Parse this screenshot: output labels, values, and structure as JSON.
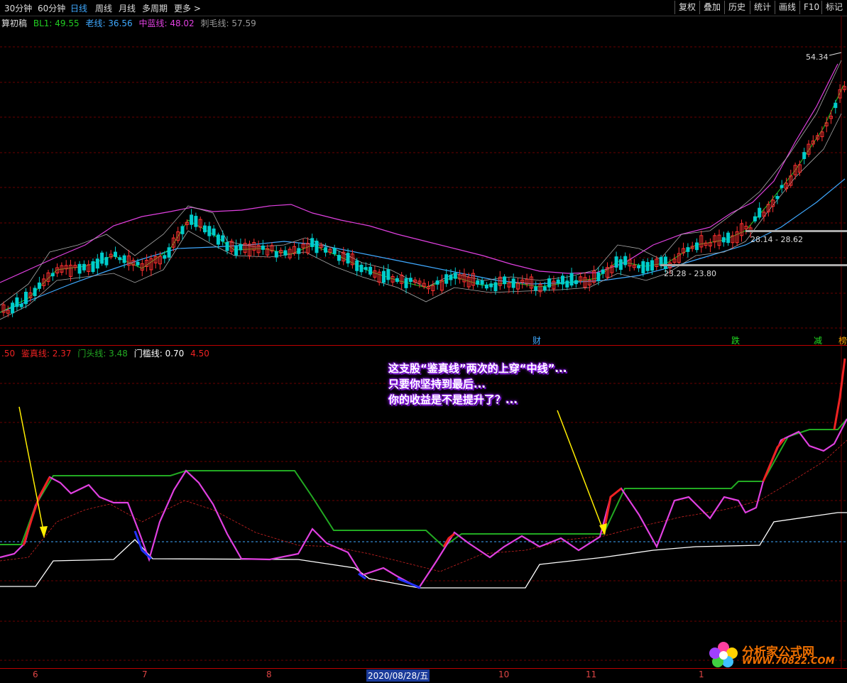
{
  "toolbar": {
    "periods": [
      "30分钟",
      "60分钟",
      "日线",
      "周线",
      "月线",
      "多周期",
      "更多 >"
    ],
    "active_period": "日线",
    "right_buttons": [
      "复权",
      "叠加",
      "历史",
      "统计",
      "画线",
      "F10",
      "标记"
    ]
  },
  "main_legend": {
    "indicator": "算初稿",
    "items": [
      {
        "label": "BL1: 49.55",
        "color": "#22cc22"
      },
      {
        "label": "老线: 36.56",
        "color": "#3fa9ff"
      },
      {
        "label": "中蓝线: 48.02",
        "color": "#e040e0"
      },
      {
        "label": "刺毛线: 57.59",
        "color": "#999999"
      }
    ]
  },
  "price_labels": {
    "high": "54.34",
    "level1": "28.14 - 28.62",
    "level2": "23.28 - 23.80"
  },
  "events": [
    {
      "label": "财",
      "color": "#3fa9ff"
    },
    {
      "label": "跌",
      "color": "#22dd22"
    },
    {
      "label": "减",
      "color": "#22dd22"
    },
    {
      "label": "榜",
      "color": "#f0a000"
    }
  ],
  "sub_legend": {
    "prefix": ".50",
    "items": [
      {
        "label": "鉴真线: 2.37",
        "color": "#ee2222"
      },
      {
        "label": "门头线: 3.48",
        "color": "#22aa22"
      },
      {
        "label": "门槛线: 0.70",
        "color": "#ffffff"
      },
      {
        "label": "4.50",
        "color": "#ee2222"
      }
    ]
  },
  "annotation": {
    "line1": "这支股“鉴真线”两次的上穿“中线”...",
    "line2": "只要你坚持到最后...",
    "line3": "你的收益是不是提升了？..."
  },
  "x_axis": {
    "labels": [
      "6",
      "7",
      "8",
      "2020/08/28/五",
      "10",
      "11",
      "1"
    ],
    "current": "2020/08/28/五"
  },
  "watermark": {
    "name": "分析家公式网",
    "url": "WWW.70822.COM"
  },
  "colors": {
    "up_candle": "#ff3030",
    "down_candle": "#00cccc",
    "mid_line": "#e040e0",
    "old_line": "#3fa9ff",
    "bl1": "#22cc22",
    "jianzhen": "#ee2222",
    "mentou": "#22aa22",
    "menkan": "#ffffff"
  }
}
